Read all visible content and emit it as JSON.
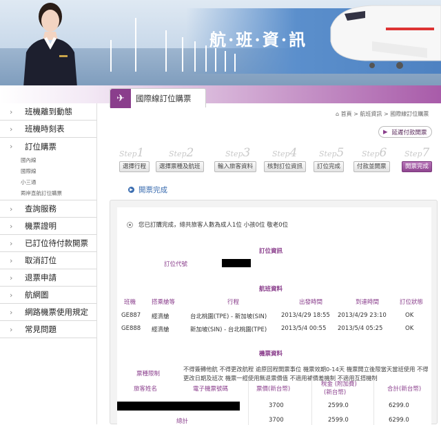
{
  "banner": {
    "title": "航·班·資·訊"
  },
  "colors": {
    "brand_purple": "#8a3e8c",
    "link_blue": "#3b6db0"
  },
  "sidebar": {
    "items": [
      {
        "label": "班機離到動態"
      },
      {
        "label": "班機時刻表"
      },
      {
        "label": "訂位購票",
        "subitems": [
          "國內線",
          "國際線",
          "小三通",
          "兩岸直航訂位購票"
        ]
      },
      {
        "label": "查詢服務"
      },
      {
        "label": "機票證明"
      },
      {
        "label": "已訂位待付款開票"
      },
      {
        "label": "取消訂位"
      },
      {
        "label": "退票申請"
      },
      {
        "label": "航網圖"
      },
      {
        "label": "網路機票使用規定"
      },
      {
        "label": "常見問題"
      }
    ]
  },
  "section": {
    "title": "國際線訂位購票",
    "icon": "airplane-icon"
  },
  "breadcrumb": "首頁 > 航班資訊 > 國際線訂位購票",
  "pay_button": "延遲付款開票",
  "steps": [
    {
      "num": "1",
      "label": "選擇行程"
    },
    {
      "num": "2",
      "label": "選擇票種及航班"
    },
    {
      "num": "3",
      "label": "輸入旅客資料"
    },
    {
      "num": "4",
      "label": "核對訂位資訊"
    },
    {
      "num": "5",
      "label": "訂位完成"
    },
    {
      "num": "6",
      "label": "付款並開票"
    },
    {
      "num": "7",
      "label": "開票完成"
    }
  ],
  "step_word": "Step",
  "done_title": "開票完成",
  "notice": "您已訂購完成，總共旅客人數為成人1位 小孩0位 敬老0位",
  "booking": {
    "title": "訂位資訊",
    "code_label": "訂位代號"
  },
  "flights": {
    "title": "航班資料",
    "headers": [
      "班機",
      "搭乘艙等",
      "行程",
      "出發時間",
      "到達時間",
      "訂位狀態"
    ],
    "rows": [
      [
        "GE887",
        "經濟艙",
        "台北桃園(TPE) - 新加坡(SIN)",
        "2013/4/29 18:55",
        "2013/4/29 23:10",
        "OK"
      ],
      [
        "GE888",
        "經濟艙",
        "新加坡(SIN) - 台北桃園(TPE)",
        "2013/5/4 00:55",
        "2013/5/4 05:25",
        "OK"
      ]
    ]
  },
  "tickets": {
    "title": "機票資料",
    "rules_label": "票種限制",
    "rules_text": "不得簽轉他航 不得更改航程 逾原回程開票事位 機票效期0-14天 機票開立後限當天當班使用 不得更改日期及班次 機票一經使用無退票價值 不適用補價差機制 不適用互搭機制",
    "headers": [
      "旅客姓名",
      "電子機票號碼",
      "票價(新台幣)",
      "稅金 (附加費)",
      "(新台幣)",
      "合計(新台幣)"
    ],
    "rows": [
      {
        "name": "",
        "fare": "3700",
        "tax": "2599.0",
        "total": "6299.0"
      },
      {
        "name": "總計",
        "fare": "3700",
        "tax": "2599.0",
        "total": "6299.0"
      }
    ]
  }
}
